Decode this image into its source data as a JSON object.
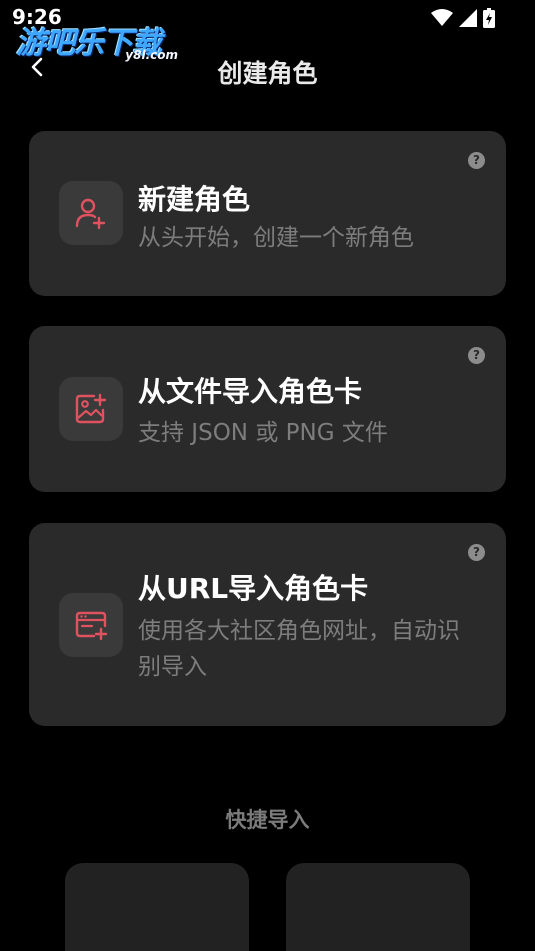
{
  "status_bar": {
    "time": "9:26"
  },
  "watermark": {
    "logo_text": "游吧乐下载",
    "domain": "y8l.com"
  },
  "header": {
    "title": "创建角色"
  },
  "cards": [
    {
      "title": "新建角色",
      "description": "从头开始，创建一个新角色",
      "icon": "person-add-icon",
      "help": "?"
    },
    {
      "title": "从文件导入角色卡",
      "description": "支持 JSON 或 PNG 文件",
      "icon": "image-add-icon",
      "help": "?"
    },
    {
      "title": "从URL导入角色卡",
      "description": "使用各大社区角色网址，自动识别导入",
      "icon": "browser-add-icon",
      "help": "?"
    }
  ],
  "quick_import": {
    "label": "快捷导入"
  },
  "colors": {
    "accent": "#e0525f",
    "card_bg": "#2a2a2a",
    "icon_bg": "#3a3a3a"
  }
}
